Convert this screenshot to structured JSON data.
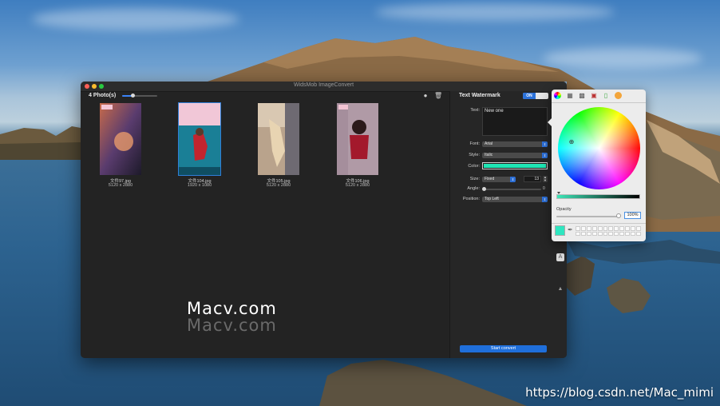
{
  "window": {
    "title": "WidsMob ImageConvert"
  },
  "toolbar": {
    "photo_count": "4 Photo(s)",
    "zoom_slider_value": 0.3
  },
  "photos": [
    {
      "name": "文件97.jpg",
      "dimensions": "5120 x 2880",
      "selected": false
    },
    {
      "name": "文件104.jpg",
      "dimensions": "1920 x 1080",
      "selected": true
    },
    {
      "name": "文件105.jpg",
      "dimensions": "5120 x 2880",
      "selected": false
    },
    {
      "name": "文件106.jpg",
      "dimensions": "5120 x 2880",
      "selected": false
    }
  ],
  "overlay_watermark": "Macv.com",
  "panel": {
    "title": "Text Watermark",
    "toggle_label": "ON",
    "text_label": "Text:",
    "text_value": "New one",
    "font_label": "Font:",
    "font_value": "Arial",
    "style_label": "Style:",
    "style_value": "Italic",
    "color_label": "Color:",
    "color_value": "#1ee6b4",
    "size_label": "Size:",
    "size_mode": "Fixed",
    "size_value": "13",
    "angle_label": "Angle:",
    "angle_value": "0",
    "position_label": "Position:",
    "position_value": "Top Left",
    "start_button": "Start convert"
  },
  "color_picker": {
    "opacity_label": "Opacity",
    "opacity_value": "100%",
    "current_color": "#2ee6c0"
  },
  "desktop": {
    "footer_text": "https://blog.csdn.net/Mac_mimi"
  }
}
